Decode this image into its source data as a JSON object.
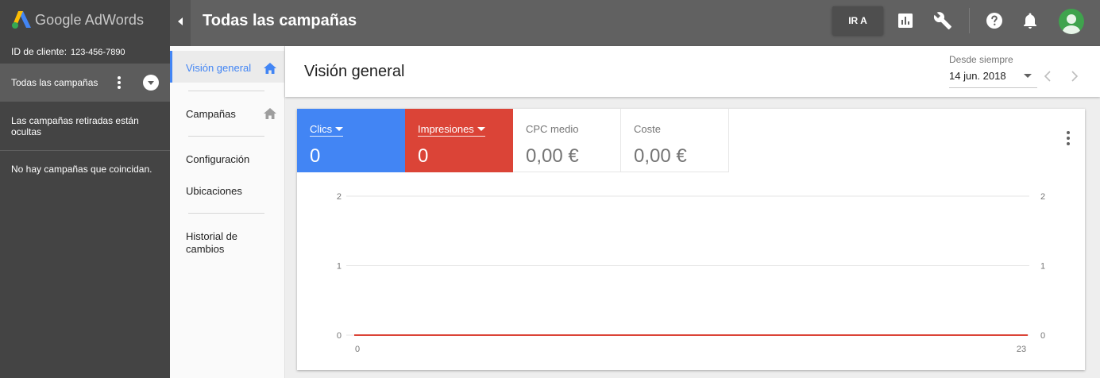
{
  "app": {
    "logo_text": "Google AdWords",
    "page_title": "Todas las campañas",
    "goto_label": "IR A"
  },
  "sidebar": {
    "client_id_label": "ID de cliente:",
    "client_id": "123-456-7890",
    "all_campaigns": "Todas las campañas",
    "retired_notice": "Las campañas retiradas están ocultas",
    "no_match": "No hay campañas que coincidan."
  },
  "nav": {
    "items": [
      {
        "label": "Visión general",
        "active": true
      },
      {
        "label": "Campañas"
      },
      {
        "label": "Configuración"
      },
      {
        "label": "Ubicaciones"
      },
      {
        "label": "Historial de cambios"
      }
    ]
  },
  "main": {
    "heading": "Visión general",
    "date_caption": "Desde siempre",
    "date_value": "14 jun. 2018"
  },
  "metrics": [
    {
      "name": "Clics",
      "value": "0",
      "color": "#4285f4",
      "selected": true
    },
    {
      "name": "Impresiones",
      "value": "0",
      "color": "#db4437",
      "selected": true
    },
    {
      "name": "CPC medio",
      "value": "0,00 €"
    },
    {
      "name": "Coste",
      "value": "0,00 €"
    }
  ],
  "colors": {
    "accent": "#4285f4",
    "impressions": "#db4437",
    "header": "#616161",
    "sidebar": "#444444"
  },
  "icons": [
    "reports-icon",
    "wrench-icon",
    "help-icon",
    "bell-icon",
    "avatar",
    "home-icon",
    "chevron-left-icon",
    "chevron-right-icon",
    "more-vert-icon"
  ],
  "chart_data": {
    "type": "line",
    "x": [
      0,
      23
    ],
    "x_tick_labels": [
      "0",
      "23"
    ],
    "y_ticks": [
      0,
      1,
      2
    ],
    "y_right_ticks": [
      0,
      1,
      2
    ],
    "ylim": [
      0,
      2
    ],
    "xlim": [
      0,
      23
    ],
    "grid": true,
    "series": [
      {
        "name": "Clics",
        "color": "#4285f4",
        "values": [
          0,
          0
        ]
      },
      {
        "name": "Impresiones",
        "color": "#db4437",
        "values": [
          0,
          0
        ]
      }
    ]
  }
}
